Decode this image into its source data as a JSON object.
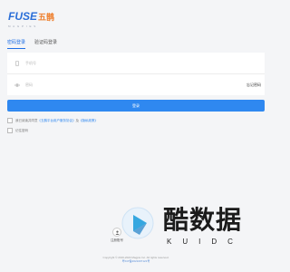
{
  "logo": {
    "brand_latin": "FUSE",
    "brand_zh": "五鹊",
    "tagline": "M A G P I E S"
  },
  "tabs": [
    {
      "label": "密码登录",
      "active": true
    },
    {
      "label": "验证码登录",
      "active": false
    }
  ],
  "form": {
    "phone_placeholder": "手机号",
    "password_placeholder": "密码",
    "forgot_label": "忘记密码",
    "phone_icon": "phone-icon",
    "password_icon": "eye-icon"
  },
  "login_button": "登录",
  "agreement": {
    "prefix": "我已阅读并同意",
    "terms_link": "《五鹊平台用户服务协议》",
    "and": "及",
    "privacy_link": "《隐私政策》"
  },
  "remember_label": "记住密码",
  "third_party": {
    "label": "注册账号",
    "icon": "user-icon"
  },
  "watermark": {
    "text": "酷数据",
    "sub": "KUIDC"
  },
  "footer": {
    "copyright": "Copyright © 2016-2024 Magpie Inc. All rights reserved.",
    "icp": "粤ICP备2021007121号"
  },
  "colors": {
    "accent": "#2f88f0",
    "brand_orange": "#ee7f2d",
    "background": "#f4f5f7"
  }
}
